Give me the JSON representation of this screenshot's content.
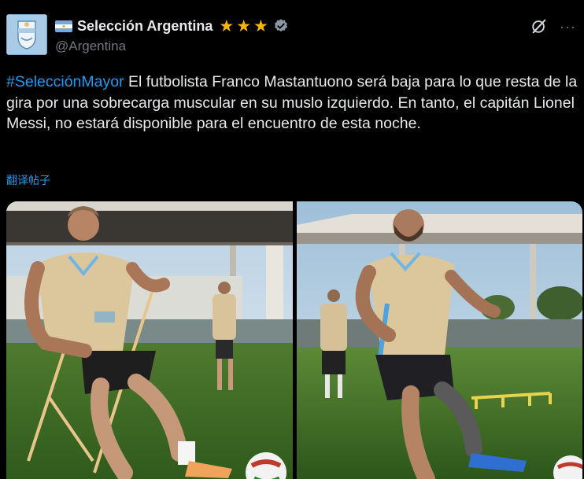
{
  "account": {
    "display_name": "Selección Argentina",
    "handle": "@Argentina",
    "stars": 3,
    "star_color": "#f7b500",
    "verified_color": "#8b98a5"
  },
  "tweet": {
    "hashtag": "#SelecciónMayor",
    "body": " El futbolista Franco Mastantuono será baja para lo que resta de la gira por una sobrecarga muscular en su muslo izquierdo. En tanto, el capitán Lionel Messi, no estará disponible para el encuentro de esta noche.",
    "translate_label": "翻译帖子"
  },
  "icons": {
    "grok": "grok-icon",
    "more": "more-icon",
    "flag": "argentina-flag-icon",
    "verified": "verified-badge-icon"
  },
  "colors": {
    "background": "#000000",
    "text": "#e7e9ea",
    "secondary": "#71767b",
    "link": "#1d9bf0"
  }
}
